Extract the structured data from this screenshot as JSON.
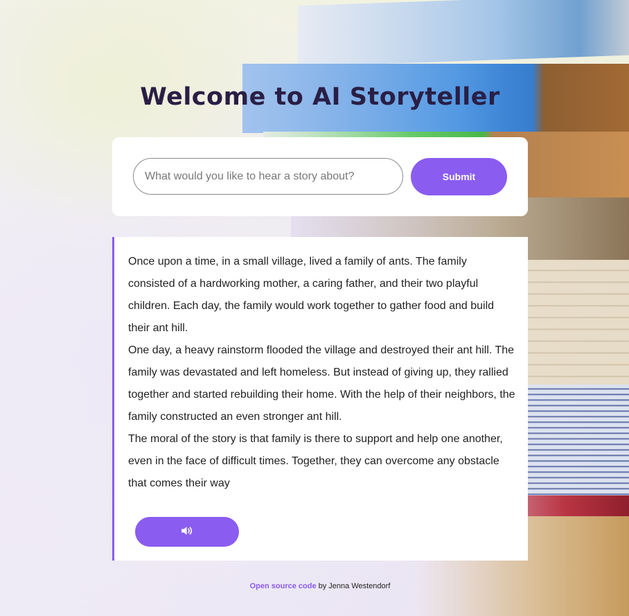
{
  "header": {
    "title": "Welcome to AI Storyteller"
  },
  "search": {
    "placeholder": "What would you like to hear a story about?",
    "value": "",
    "submit_label": "Submit"
  },
  "story": {
    "paragraphs": [
      "Once upon a time, in a small village, lived a family of ants. The family consisted of a hardworking mother, a caring father, and their two playful children. Each day, the family would work together to gather food and build their ant hill.",
      "One day, a heavy rainstorm flooded the village and destroyed their ant hill. The family was devastated and left homeless. But instead of giving up, they rallied together and started rebuilding their home. With the help of their neighbors, the family constructed an even stronger ant hill.",
      "The moral of the story is that family is there to support and help one another, even in the face of difficult times. Together, they can overcome any obstacle that comes their way"
    ],
    "audio_button_icon": "speaker-volume-icon"
  },
  "footer": {
    "link_text": "Open source code",
    "suffix_text": " by Jenna Westendorf"
  },
  "colors": {
    "accent": "#8a5cf0",
    "title": "#2a1e45",
    "card_background": "#ffffff"
  }
}
